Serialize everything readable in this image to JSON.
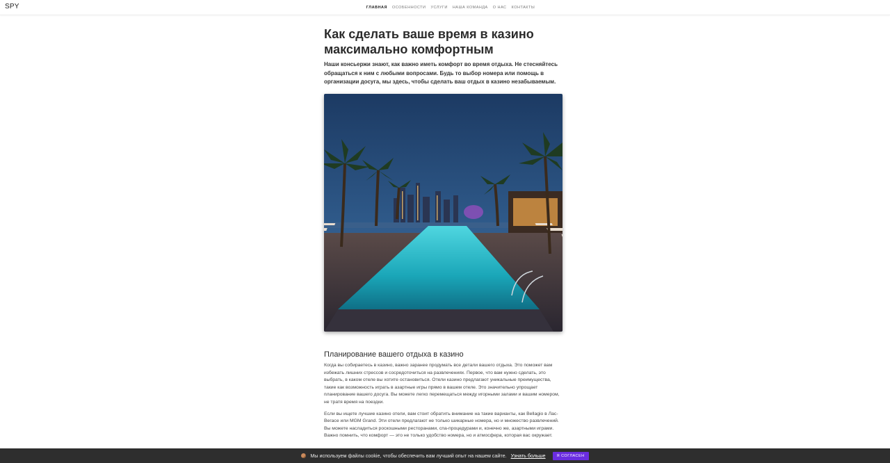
{
  "header": {
    "logo": "SPY",
    "nav": [
      {
        "label": "Главная",
        "active": true
      },
      {
        "label": "Особенности",
        "active": false
      },
      {
        "label": "Услуги",
        "active": false
      },
      {
        "label": "Наша команда",
        "active": false
      },
      {
        "label": "О нас",
        "active": false
      },
      {
        "label": "Контакты",
        "active": false
      }
    ]
  },
  "article": {
    "title": "Как сделать ваше время в казино максимально комфортным",
    "lead": "Наши консьержи знают, как важно иметь комфорт во время отдыха. Не стесняйтесь обращаться к ним с любыми вопросами. Будь то выбор номера или помощь в организации досуга, мы здесь, чтобы сделать ваш отдых в казино незабываемым.",
    "section_title": "Планирование вашего отдыха в казино",
    "paragraphs": [
      "Когда вы собираетесь в казино, важно заранее продумать все детали вашего отдыха. Это поможет вам избежать лишних стрессов и сосредоточиться на развлечениях. Первое, что вам нужно сделать, это выбрать, в каком отеле вы хотите остановиться. Отели казино предлагают уникальные преимущества, такие как возможность играть в азартные игры прямо в вашем отеле. Это значительно упрощает планирование вашего досуга. Вы можете легко перемещаться между игорными залами и вашим номером, не тратя время на поездки.",
      "Если вы ищете лучшие казино отели, вам стоит обратить внимание на такие варианты, как Bellagio в Лас-Вегасе или MGM Grand. Эти отели предлагают не только шикарные номера, но и множество развлечений. Вы можете насладиться роскошными ресторанами, спа-процедурами и, конечно же, азартными играми. Важно помнить, что комфорт — это не только удобство номера, но и атмосфера, которая вас окружает."
    ]
  },
  "cookie": {
    "text": "Мы используем файлы cookie, чтобы обеспечить вам лучший опыт на нашем сайте.",
    "link": "Узнать больше",
    "button": "Я согласен"
  }
}
